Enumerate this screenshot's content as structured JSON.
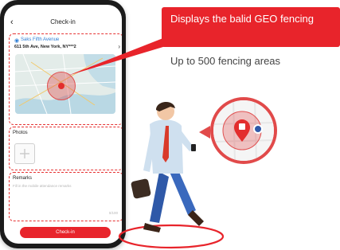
{
  "app": {
    "title": "Check-in",
    "back_icon": "back-arrow-icon",
    "location": {
      "store_name": "Saks Fifth Avenue",
      "address": "611  5th Ave, New York, NY***2",
      "pin_icon": "location-pin-icon"
    },
    "photos": {
      "label": "Photos",
      "add_icon": "plus-icon"
    },
    "remarks": {
      "label": "Remarks",
      "placeholder": "Fill in the mobile attendance remarks",
      "count": "0/100"
    },
    "checkin_button": "Check-in"
  },
  "callout": {
    "text": "Displays the balid GEO fencing"
  },
  "subtitle": "Up to 500 fencing areas",
  "colors": {
    "accent": "#e8242b",
    "link": "#2f7fd6",
    "fence": "#e05050"
  }
}
